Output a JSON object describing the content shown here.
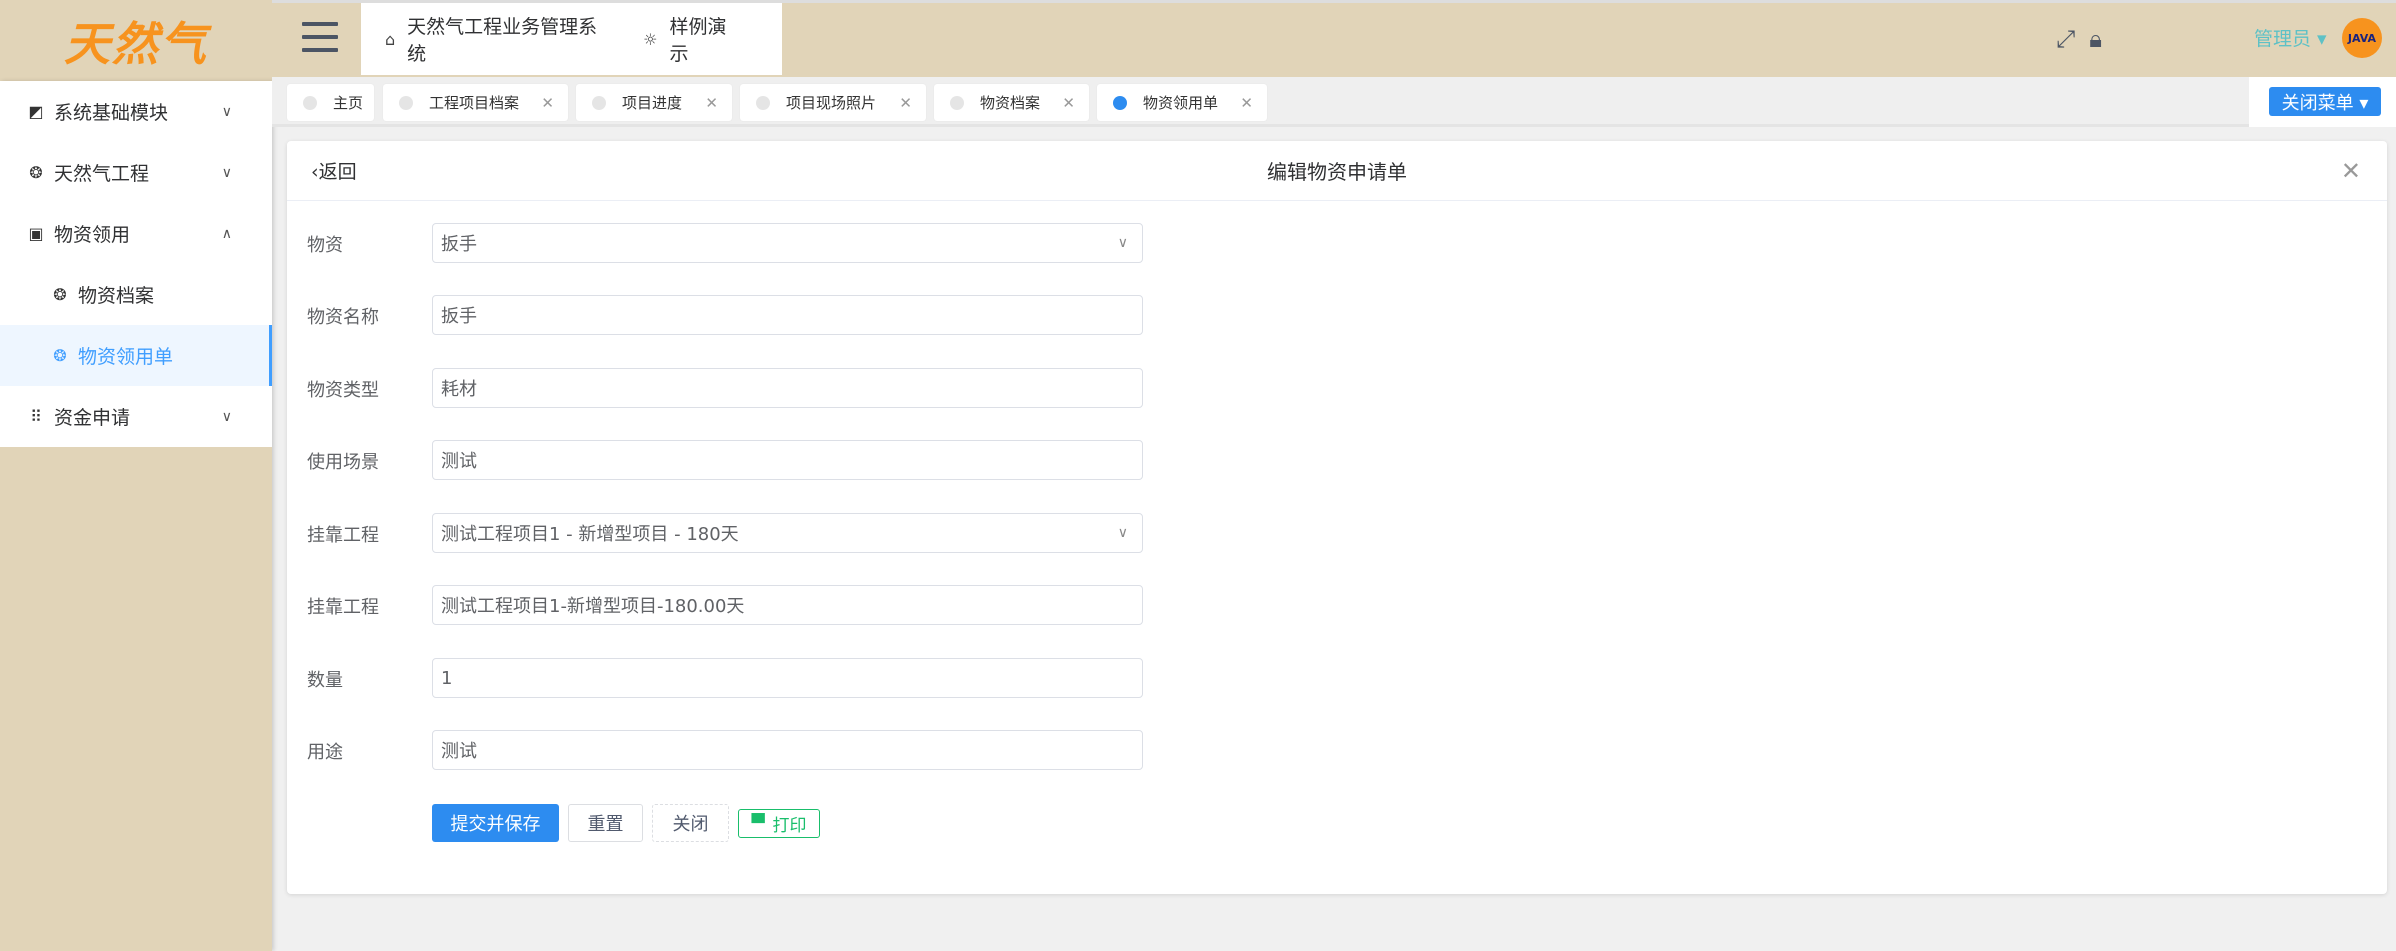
{
  "logo": "天然气",
  "sidebar": {
    "items": [
      {
        "label": "系统基础模块",
        "icon": "chart-icon",
        "chev": "⌄"
      },
      {
        "label": "天然气工程",
        "icon": "aperture-icon",
        "chev": "⌄"
      },
      {
        "label": "物资领用",
        "icon": "download-box-icon",
        "chev": "⌃"
      },
      {
        "label": "物资档案",
        "icon": "aperture-icon"
      },
      {
        "label": "物资领用单",
        "icon": "aperture-icon"
      },
      {
        "label": "资金申请",
        "icon": "grid-icon",
        "chev": "⌄"
      }
    ]
  },
  "header": {
    "nav": [
      {
        "label": "天然气工程业务管理系统",
        "icon": "home-icon"
      },
      {
        "label": "样例演示",
        "icon": "bulb-icon"
      }
    ],
    "user": "管理员 ▾",
    "avatar": "JAVA"
  },
  "tabs": [
    {
      "label": "主页"
    },
    {
      "label": "工程项目档案"
    },
    {
      "label": "项目进度"
    },
    {
      "label": "项目现场照片"
    },
    {
      "label": "物资档案"
    },
    {
      "label": "物资领用单",
      "active": true
    }
  ],
  "close_menu": "关闭菜单 ▾",
  "card": {
    "back": "‹返回",
    "title": "编辑物资申请单",
    "fields": [
      {
        "label": "物资",
        "value": "扳手",
        "type": "select"
      },
      {
        "label": "物资名称",
        "value": "扳手"
      },
      {
        "label": "物资类型",
        "value": "耗材"
      },
      {
        "label": "使用场景",
        "value": "测试"
      },
      {
        "label": "挂靠工程",
        "value": "测试工程项目1 - 新增型项目 - 180天",
        "type": "select"
      },
      {
        "label": "挂靠工程",
        "value": "测试工程项目1-新增型项目-180.00天"
      },
      {
        "label": "数量",
        "value": "1"
      },
      {
        "label": "用途",
        "value": "测试"
      }
    ],
    "buttons": {
      "submit": "提交并保存",
      "reset": "重置",
      "close": "关闭",
      "print": "打印"
    }
  },
  "colors": {
    "primary": "#2d8cf0",
    "header_bg": "#e1d4b8",
    "success": "#19be6b"
  }
}
